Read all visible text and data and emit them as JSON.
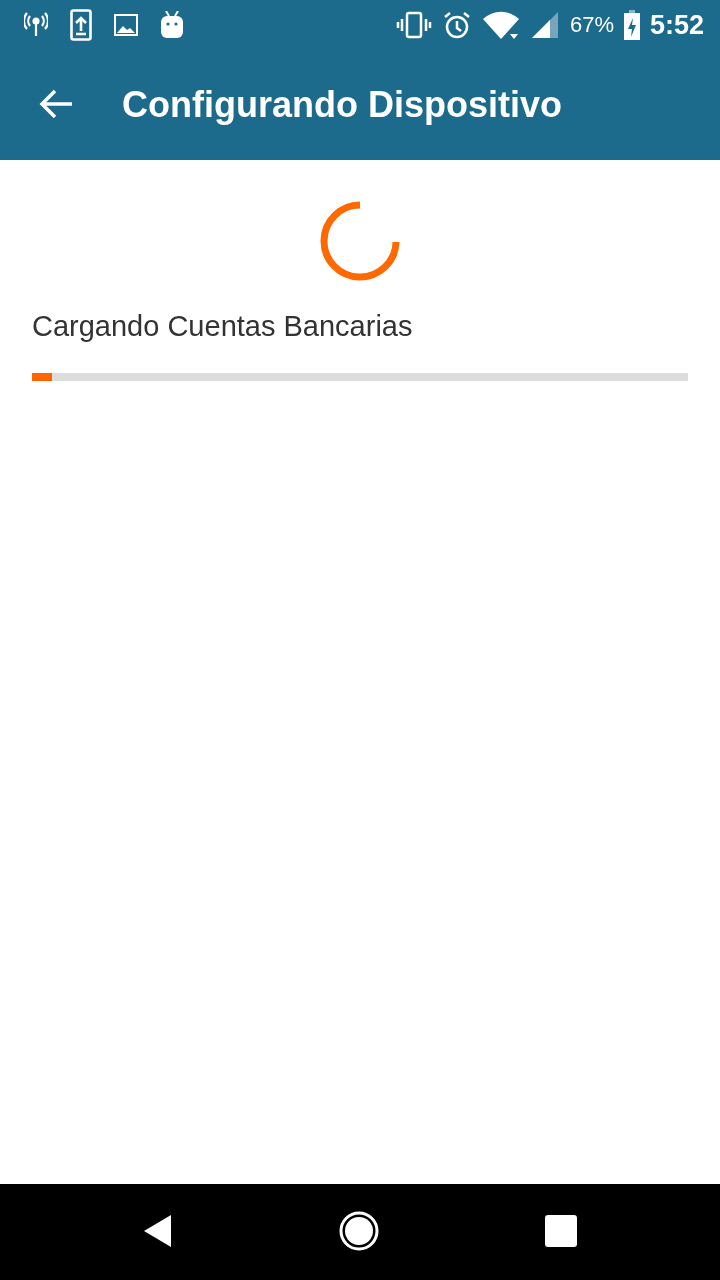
{
  "status_bar": {
    "battery_percent": "67%",
    "time": "5:52"
  },
  "app_bar": {
    "title": "Configurando Dispositivo"
  },
  "loading": {
    "message": "Cargando Cuentas Bancarias",
    "progress": {
      "level": 0.03
    }
  }
}
